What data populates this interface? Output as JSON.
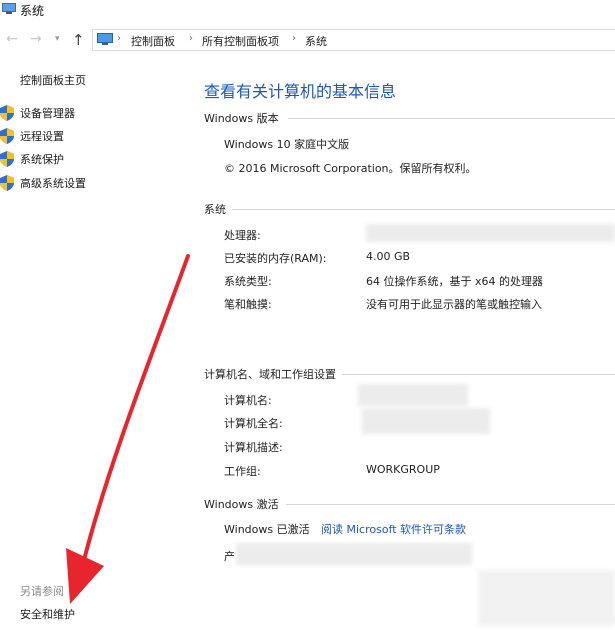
{
  "window": {
    "title": "系统"
  },
  "nav": {
    "back_icon": "back-arrow-icon",
    "forward_icon": "forward-arrow-icon",
    "up_icon": "up-arrow-icon",
    "breadcrumbs": [
      "控制面板",
      "所有控制面板项",
      "系统"
    ]
  },
  "sidebar": {
    "home": "控制面板主页",
    "items": [
      {
        "label": "设备管理器",
        "icon": "shield-icon"
      },
      {
        "label": "远程设置",
        "icon": "shield-icon"
      },
      {
        "label": "系统保护",
        "icon": "shield-icon"
      },
      {
        "label": "高级系统设置",
        "icon": "shield-icon"
      }
    ],
    "see_also": "另请参阅",
    "security_link": "安全和维护"
  },
  "main": {
    "title": "查看有关计算机的基本信息",
    "edition": {
      "heading": "Windows 版本",
      "name": "Windows 10 家庭中文版",
      "copyright": "© 2016 Microsoft Corporation。保留所有权利。"
    },
    "system": {
      "heading": "系统",
      "rows": [
        {
          "label": "处理器:",
          "value": ""
        },
        {
          "label": "已安装的内存(RAM):",
          "value": "4.00 GB"
        },
        {
          "label": "系统类型:",
          "value": "64 位操作系统，基于 x64 的处理器"
        },
        {
          "label": "笔和触摸:",
          "value": "没有可用于此显示器的笔或触控输入"
        }
      ]
    },
    "computer": {
      "heading": "计算机名、域和工作组设置",
      "rows": [
        {
          "label": "计算机名:",
          "value": ""
        },
        {
          "label": "计算机全名:",
          "value": ""
        },
        {
          "label": "计算机描述:",
          "value": ""
        },
        {
          "label": "工作组:",
          "value": "WORKGROUP"
        }
      ]
    },
    "activation": {
      "heading": "Windows 激活",
      "status": "Windows 已激活",
      "license_link": "阅读 Microsoft 软件许可条款",
      "product_prefix": "产"
    }
  },
  "colors": {
    "link_blue": "#1b58b8",
    "annotation_arrow": "#e8252c",
    "shield_blue": "#2f6fcf",
    "shield_yellow": "#f2c029"
  }
}
